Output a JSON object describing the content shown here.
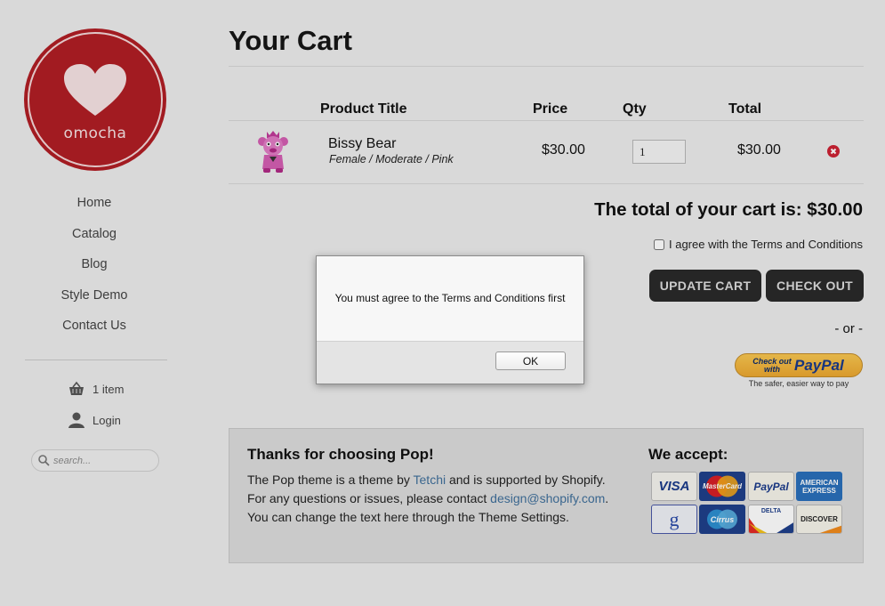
{
  "brand": {
    "name": "omocha",
    "color": "#b01e24"
  },
  "sidebar": {
    "nav": [
      {
        "label": "Home"
      },
      {
        "label": "Catalog"
      },
      {
        "label": "Blog"
      },
      {
        "label": "Style Demo"
      },
      {
        "label": "Contact Us"
      }
    ],
    "cart_label": "1 item",
    "login_label": "Login",
    "search_placeholder": "search..."
  },
  "cart": {
    "title": "Your Cart",
    "columns": {
      "product": "Product Title",
      "price": "Price",
      "qty": "Qty",
      "total": "Total"
    },
    "items": [
      {
        "name": "Bissy Bear",
        "variant": "Female / Moderate / Pink",
        "price": "$30.00",
        "qty": "1",
        "total": "$30.00",
        "image_icon": "pink-bear-icon"
      }
    ],
    "total_text": "The total of your cart is: $30.00",
    "agree_label": "I agree with the Terms and Conditions",
    "update_label": "UPDATE CART",
    "checkout_label": "CHECK OUT",
    "or_label": "- or -",
    "paypal": {
      "small": "Check out with",
      "brand": "PayPal",
      "tagline": "The safer, easier way to pay"
    }
  },
  "footer": {
    "title": "Thanks for choosing Pop!",
    "line1_pre": "The Pop theme is  a theme by ",
    "line1_link": "Tetchi",
    "line1_post": " and is supported by Shopify.",
    "line2_pre": "For any questions or issues, please contact ",
    "line2_link": "design@shopify.com",
    "line2_post": ".",
    "line3": "You can change the text here through the Theme Settings.",
    "accept_title": "We accept:",
    "cards": [
      {
        "label": "VISA",
        "icon": "visa-icon"
      },
      {
        "label": "MasterCard",
        "icon": "mastercard-icon"
      },
      {
        "label": "PayPal",
        "icon": "paypal-card-icon"
      },
      {
        "label": "AMERICAN EXPRESS",
        "icon": "amex-icon"
      },
      {
        "label": "g",
        "icon": "google-checkout-icon"
      },
      {
        "label": "Cirrus",
        "icon": "cirrus-icon"
      },
      {
        "label": "DELTA",
        "icon": "delta-icon"
      },
      {
        "label": "DISCOVER",
        "icon": "discover-icon"
      }
    ]
  },
  "dialog": {
    "message": "You must agree to the Terms and Conditions first",
    "ok_label": "OK"
  }
}
